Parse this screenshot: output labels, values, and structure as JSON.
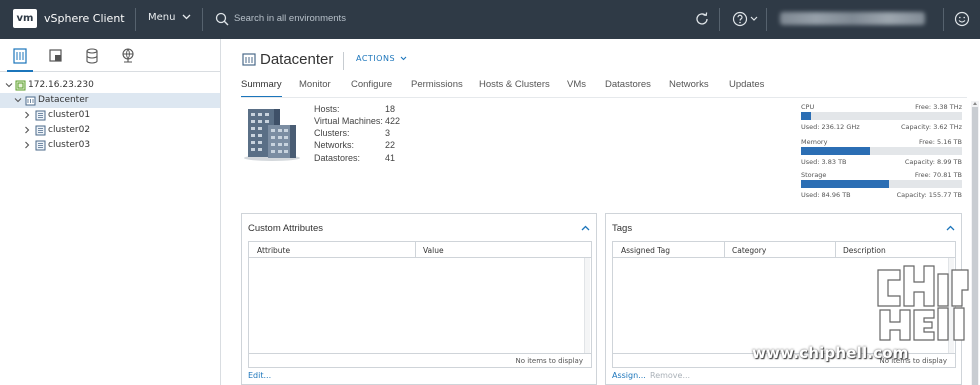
{
  "header": {
    "logo": "vm",
    "app_title": "vSphere Client",
    "menu_label": "Menu",
    "search_placeholder": "Search in all environments"
  },
  "tree": {
    "items": [
      {
        "label": "172.16.23.230"
      },
      {
        "label": "Datacenter"
      },
      {
        "label": "cluster01"
      },
      {
        "label": "cluster02"
      },
      {
        "label": "cluster03"
      }
    ]
  },
  "object": {
    "title": "Datacenter",
    "actions_label": "ACTIONS"
  },
  "tabs": [
    "Summary",
    "Monitor",
    "Configure",
    "Permissions",
    "Hosts & Clusters",
    "VMs",
    "Datastores",
    "Networks",
    "Updates"
  ],
  "stats": [
    {
      "label": "Hosts:",
      "value": "18"
    },
    {
      "label": "Virtual Machines:",
      "value": "422"
    },
    {
      "label": "Clusters:",
      "value": "3"
    },
    {
      "label": "Networks:",
      "value": "22"
    },
    {
      "label": "Datastores:",
      "value": "41"
    }
  ],
  "resources": [
    {
      "name": "CPU",
      "free": "Free: 3.38 THz",
      "used": "Used: 236.12 GHz",
      "capacity": "Capacity: 3.62 THz",
      "fraction": 0.065
    },
    {
      "name": "Memory",
      "free": "Free: 5.16 TB",
      "used": "Used: 3.83 TB",
      "capacity": "Capacity: 8.99 TB",
      "fraction": 0.426
    },
    {
      "name": "Storage",
      "free": "Free: 70.81 TB",
      "used": "Used: 84.96 TB",
      "capacity": "Capacity: 155.77 TB",
      "fraction": 0.545
    }
  ],
  "custom_attributes": {
    "title": "Custom Attributes",
    "columns": [
      "Attribute",
      "Value"
    ],
    "empty_text": "No items to display",
    "edit_label": "Edit..."
  },
  "tags": {
    "title": "Tags",
    "columns": [
      "Assigned Tag",
      "Category",
      "Description"
    ],
    "empty_text": "No items to display",
    "assign_label": "Assign...",
    "remove_label": "Remove..."
  },
  "watermark": {
    "text": "www.chiphell.com"
  },
  "colors": {
    "header_bg": "#2f3a46",
    "accent": "#1b75bb",
    "bar_fill": "#2b6eb4",
    "selected_row": "#dde7f1"
  }
}
